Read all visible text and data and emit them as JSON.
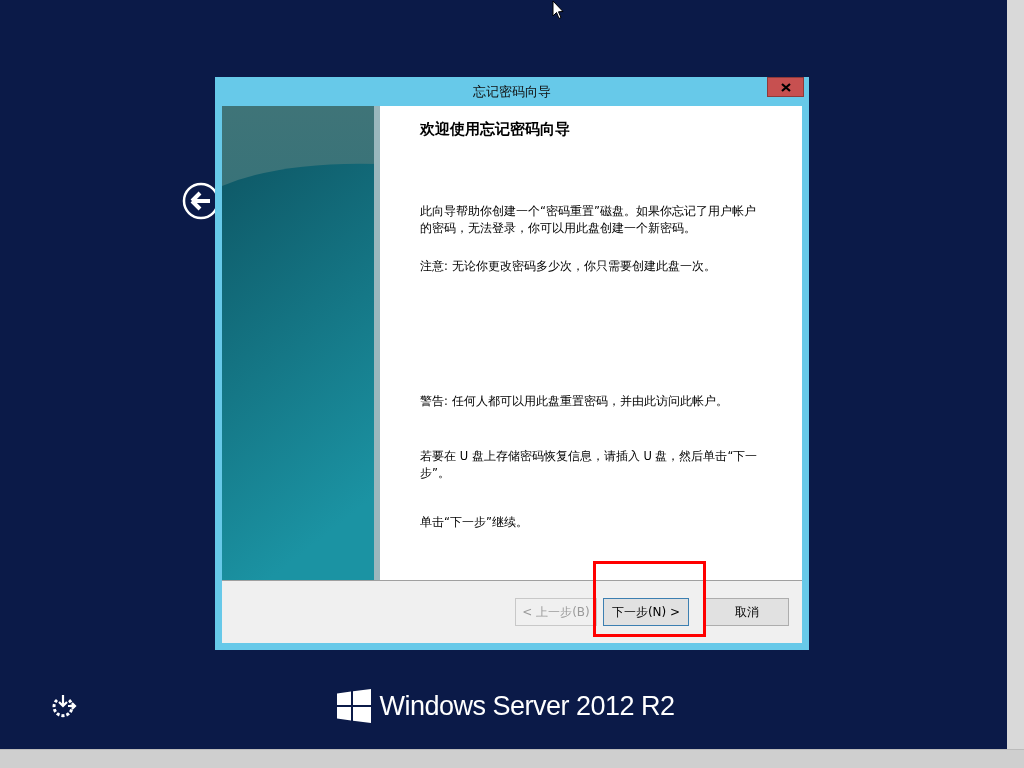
{
  "dialog": {
    "title": "忘记密码向导",
    "heading": "欢迎使用忘记密码向导",
    "paragraphs": [
      "此向导帮助你创建一个“密码重置”磁盘。如果你忘记了用户帐户的密码，无法登录，你可以用此盘创建一个新密码。",
      "注意: 无论你更改密码多少次，你只需要创建此盘一次。",
      "警告: 任何人都可以用此盘重置密码，并由此访问此帐户。",
      "若要在 U 盘上存储密码恢复信息，请插入 U 盘，然后单击“下一步”。",
      "单击“下一步”继续。"
    ],
    "buttons": [
      {
        "label": "< 上一步(B)",
        "disabled": true,
        "default": false
      },
      {
        "label": "下一步(N) >",
        "disabled": false,
        "default": true
      },
      {
        "label": "取消",
        "disabled": false,
        "default": false
      }
    ]
  },
  "brand": "Windows Server 2012 R2"
}
